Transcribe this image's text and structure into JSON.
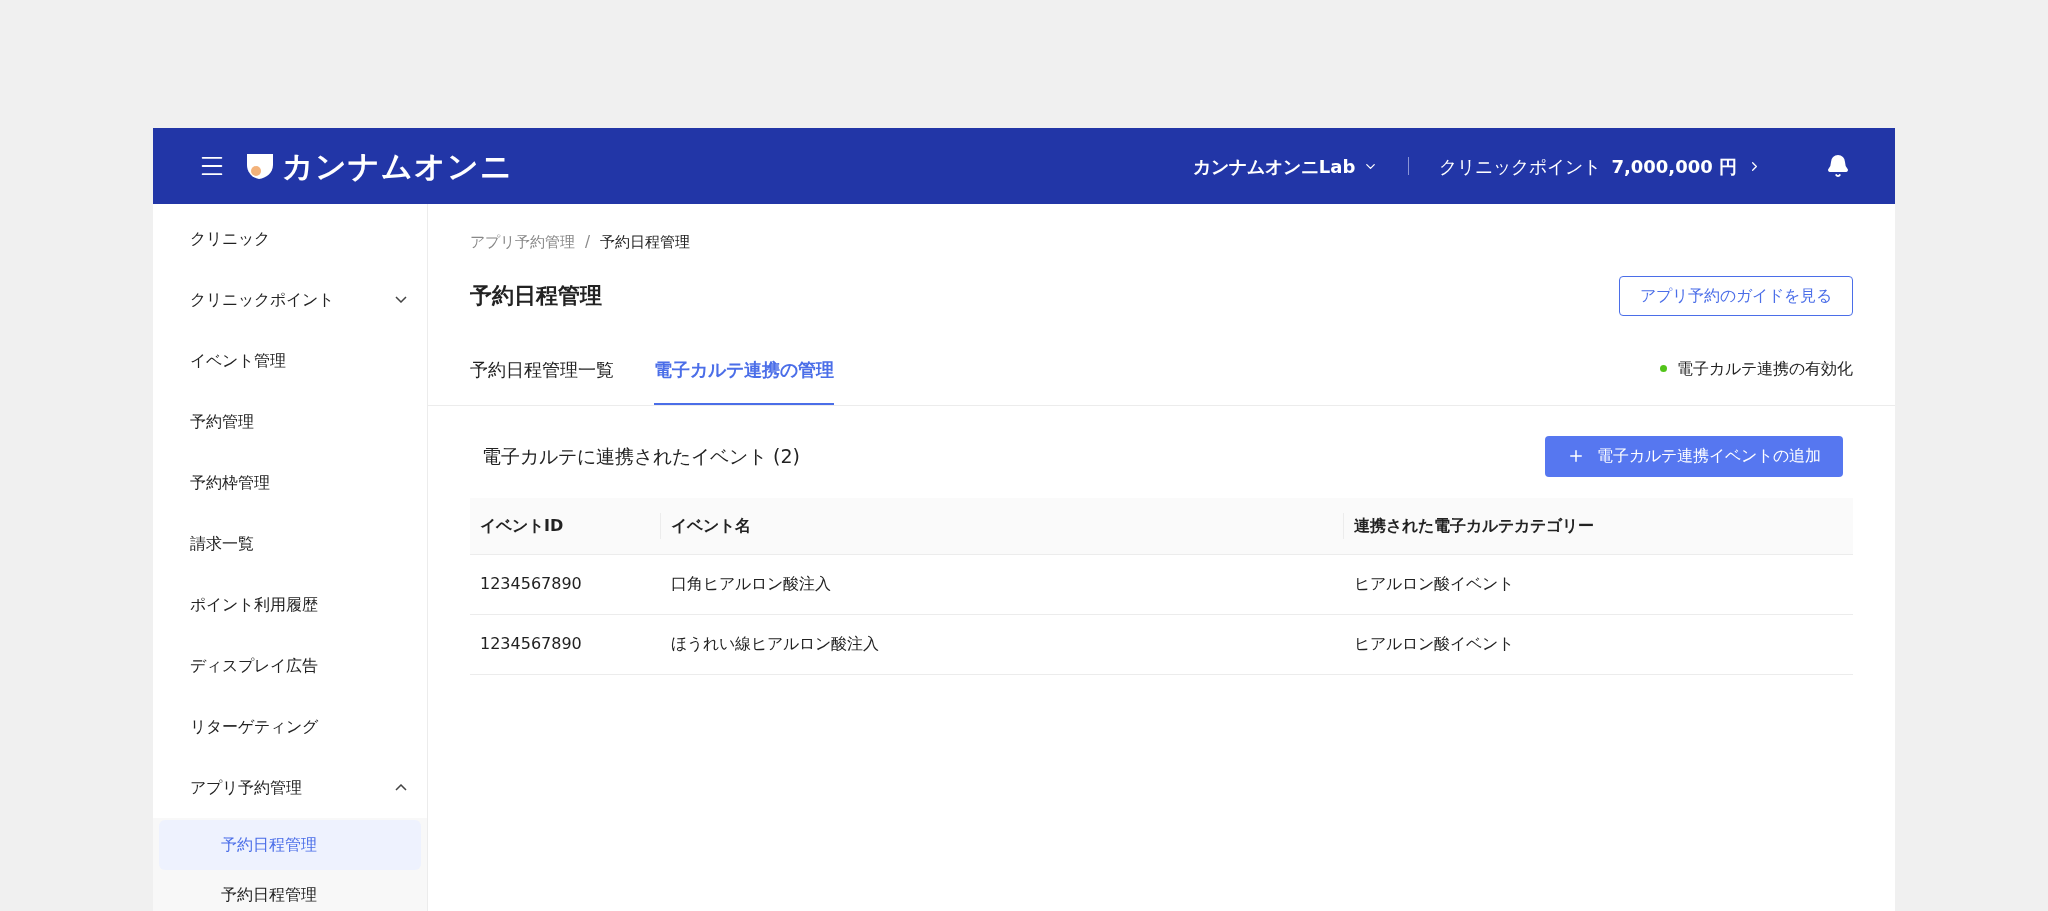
{
  "header": {
    "logo": "カンナムオンニ",
    "account": "カンナムオンニLab",
    "points_label": "クリニックポイント",
    "points_value": "7,000,000 円"
  },
  "sidebar": {
    "items": [
      {
        "label": "クリニック"
      },
      {
        "label": "クリニックポイント",
        "expanded": false
      },
      {
        "label": "イベント管理"
      },
      {
        "label": "予約管理"
      },
      {
        "label": "予約枠管理"
      },
      {
        "label": "請求一覧"
      },
      {
        "label": "ポイント利用履歴"
      },
      {
        "label": "ディスプレイ広告"
      },
      {
        "label": "リターゲティング"
      },
      {
        "label": "アプリ予約管理",
        "expanded": true,
        "children": [
          {
            "label": "予約日程管理",
            "selected": true
          },
          {
            "label": "予約日程管理",
            "selected": false
          }
        ]
      }
    ]
  },
  "breadcrumb": [
    "アプリ予約管理",
    "/",
    "予約日程管理"
  ],
  "page_title": "予約日程管理",
  "guide_button": "アプリ予約のガイドを見る",
  "tabs": [
    {
      "label": "予約日程管理一覧",
      "selected": false
    },
    {
      "label": "電子カルテ連携の管理",
      "selected": true
    }
  ],
  "status": {
    "label": "電子カルテ連携の有効化",
    "on": true
  },
  "section": {
    "title": "電子カルテに連携されたイベント (2)",
    "add_button": "電子カルテ連携イベントの追加"
  },
  "table": {
    "columns": [
      "イベントID",
      "イベント名",
      "連携された電子カルテカテゴリー"
    ],
    "rows": [
      [
        "1234567890",
        "口角ヒアルロン酸注入",
        "ヒアルロン酸イベント"
      ],
      [
        "1234567890",
        "ほうれい線ヒアルロン酸注入",
        "ヒアルロン酸イベント"
      ]
    ]
  }
}
